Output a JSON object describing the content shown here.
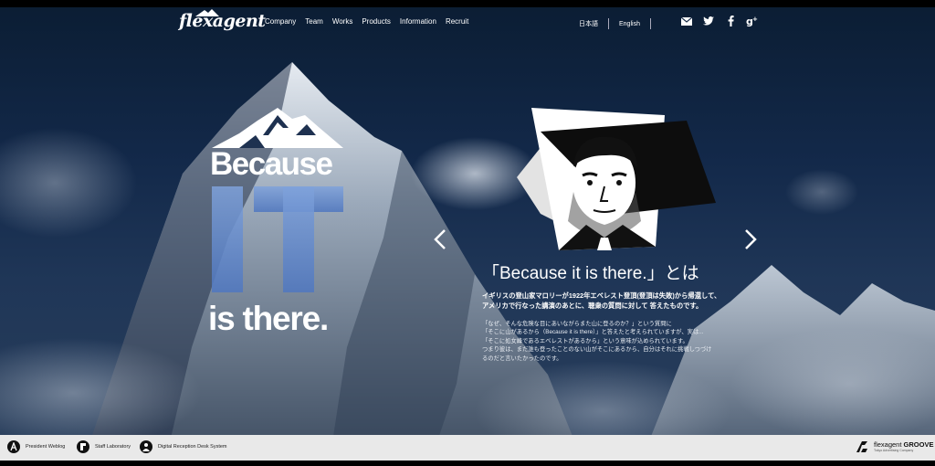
{
  "header": {
    "logo": "flexagent",
    "nav": [
      "Company",
      "Team",
      "Works",
      "Products",
      "Information",
      "Recruit"
    ],
    "lang_ja": "日本語",
    "lang_en": "English",
    "social_icons": [
      "mail-icon",
      "twitter-icon",
      "facebook-icon",
      "google-plus-icon"
    ]
  },
  "hero": {
    "because": "Because",
    "it": "IT",
    "is_there": "is there."
  },
  "slide": {
    "quote_title": "「Because it is there.」とは",
    "lead": [
      "イギリスの登山家マロリーが1922年エベレスト登頂(登頂は失敗)から帰還して、",
      "アメリカで行なった講演のあとに、聴衆の質問に対して 答えたものです。"
    ],
    "body": [
      "「なぜ、そんな危険な目にあいながらまた山に登るのか？」という質問に",
      "「そこに山があるから（Because it is there）」と答えたと考えられていますが、実は...",
      "「そこに処女峰であるエベレストがあるから」という意味が込められています。",
      "つまり彼は、まだ誰も登ったことのない山がそこにあるから、自分はそれに挑戦しつづけ",
      "るのだと言いたかったのです。"
    ]
  },
  "footer": {
    "links": [
      "President Weblog",
      "Staff Laboratory",
      "Digital Reception Desk System"
    ],
    "brand": "flexagent",
    "brand_strong": "GROOVE",
    "brand_sub": "Tokyo Advertising Company"
  }
}
